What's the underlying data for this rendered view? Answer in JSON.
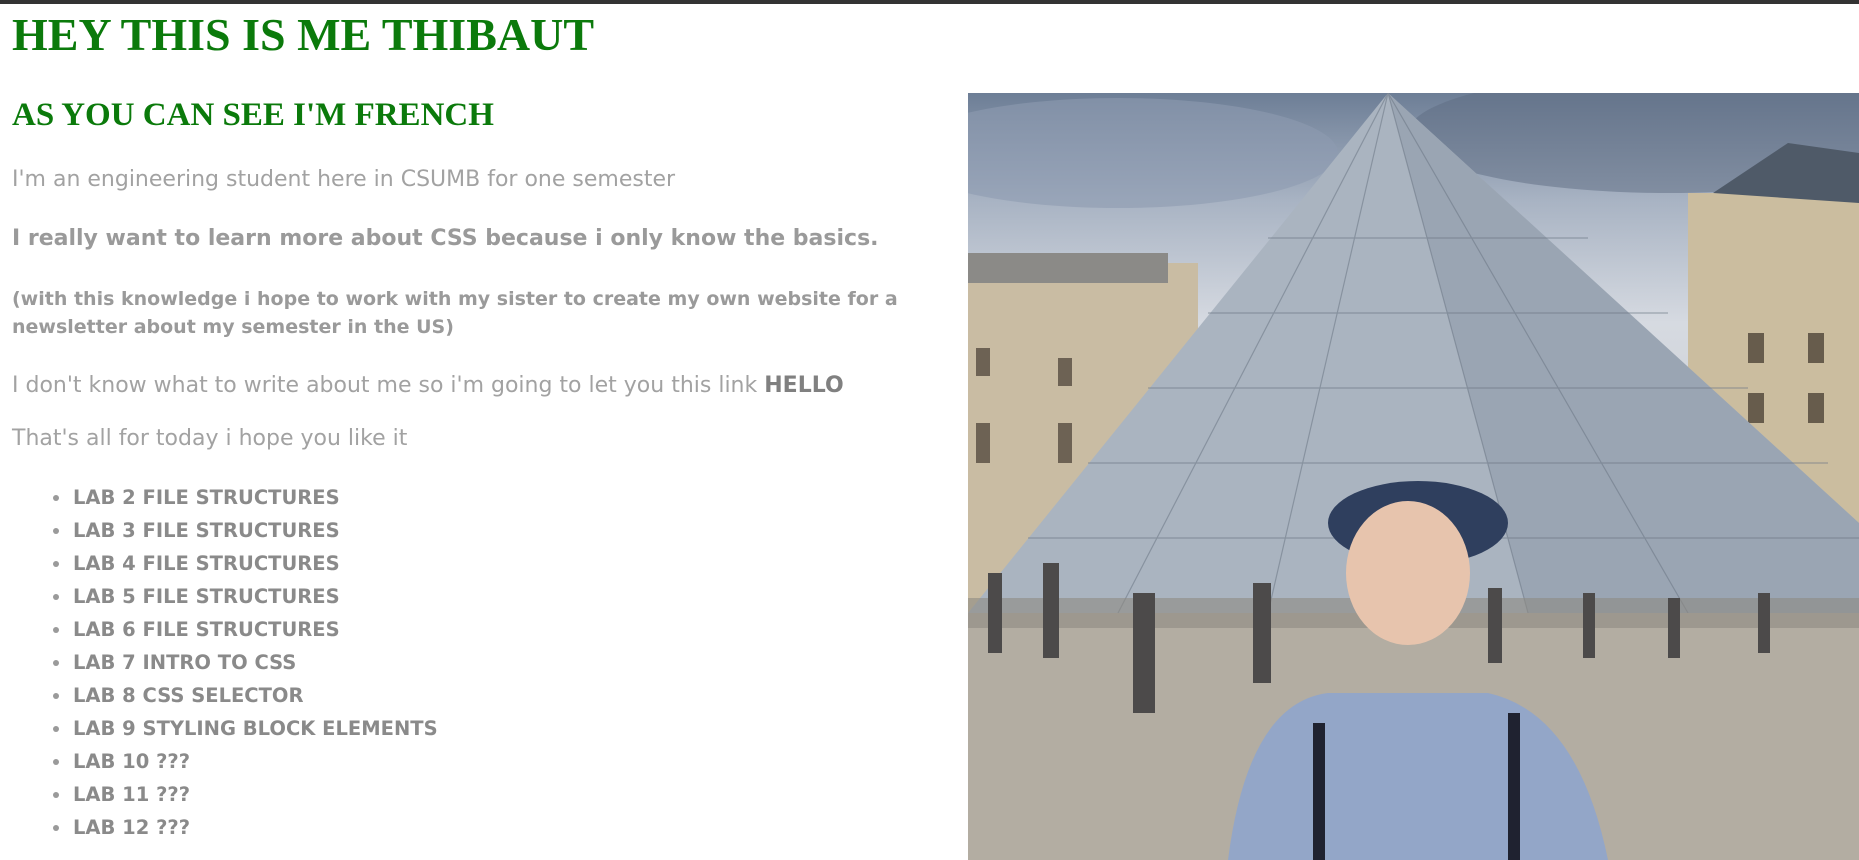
{
  "page": {
    "title": "HEY THIS IS ME THIBAUT",
    "subtitle": "AS YOU CAN SEE I'M FRENCH",
    "intro": "I'm an engineering student here in CSUMB for one semester",
    "learn": "I really want to learn more about CSS because i only know the basics.",
    "hope": "(with this knowledge i hope to work with my sister to create my own website for a newsletter about my semester in the US)",
    "link_text": "I don't know what to write about me so i'm going to let you this link",
    "link_label": "HELLO",
    "outro": "That's all for today i hope you like it"
  },
  "labs": [
    "LAB 2 FILE STRUCTURES",
    "LAB 3 FILE STRUCTURES",
    "LAB 4 FILE STRUCTURES",
    "LAB 5 FILE STRUCTURES",
    "LAB 6 FILE STRUCTURES",
    "LAB 7 INTRO TO CSS",
    "LAB 8 CSS SELECTOR",
    "LAB 9 STYLING BLOCK ELEMENTS",
    "LAB 10 ???",
    "LAB 11 ???",
    "LAB 12 ???"
  ],
  "colors": {
    "heading": "#0b7a0b",
    "text": "#a2a2a2",
    "list": "#8a8a8a"
  }
}
